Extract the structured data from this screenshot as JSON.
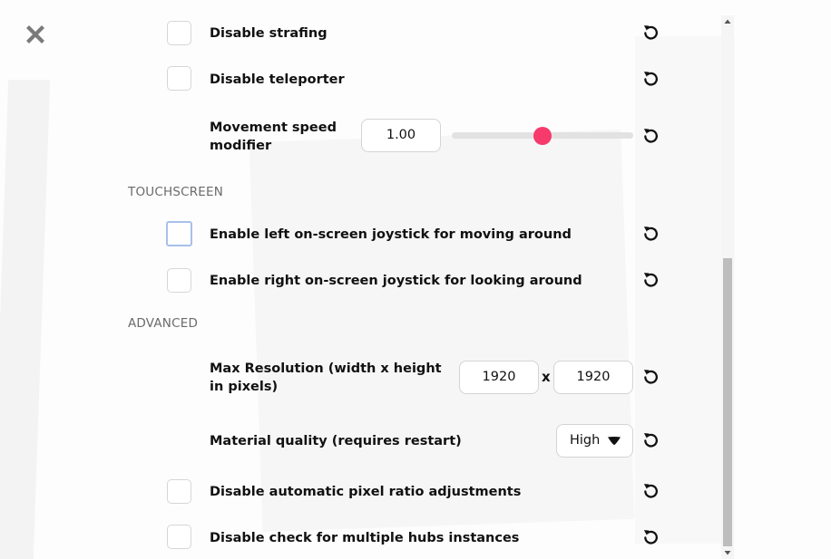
{
  "close_icon": "close-icon",
  "reset_icon": "reset-icon",
  "settings": {
    "disable_strafing": {
      "label": "Disable strafing",
      "checked": false
    },
    "disable_teleporter": {
      "label": "Disable teleporter",
      "checked": false
    },
    "movement_speed": {
      "label": "Movement speed modifier",
      "value": "1.00",
      "slider_fraction": 0.5
    },
    "touchscreen": {
      "heading": "TOUCHSCREEN",
      "left_joystick": {
        "label": "Enable left on-screen joystick for moving around",
        "checked": false
      },
      "right_joystick": {
        "label": "Enable right on-screen joystick for looking around",
        "checked": false
      }
    },
    "advanced": {
      "heading": "ADVANCED",
      "max_resolution": {
        "label": "Max Resolution (width x height in pixels)",
        "width": "1920",
        "separator": "x",
        "height": "1920"
      },
      "material_quality": {
        "label": "Material quality (requires restart)",
        "value": "High"
      },
      "pixel_ratio": {
        "label": "Disable automatic pixel ratio adjustments",
        "checked": false
      },
      "multiple_hubs": {
        "label": "Disable check for multiple hubs instances",
        "checked": false
      }
    }
  },
  "colors": {
    "slider_thumb": "#f63a6c",
    "section_heading": "#6b6b6b",
    "focus_border": "#a8c0ea"
  }
}
